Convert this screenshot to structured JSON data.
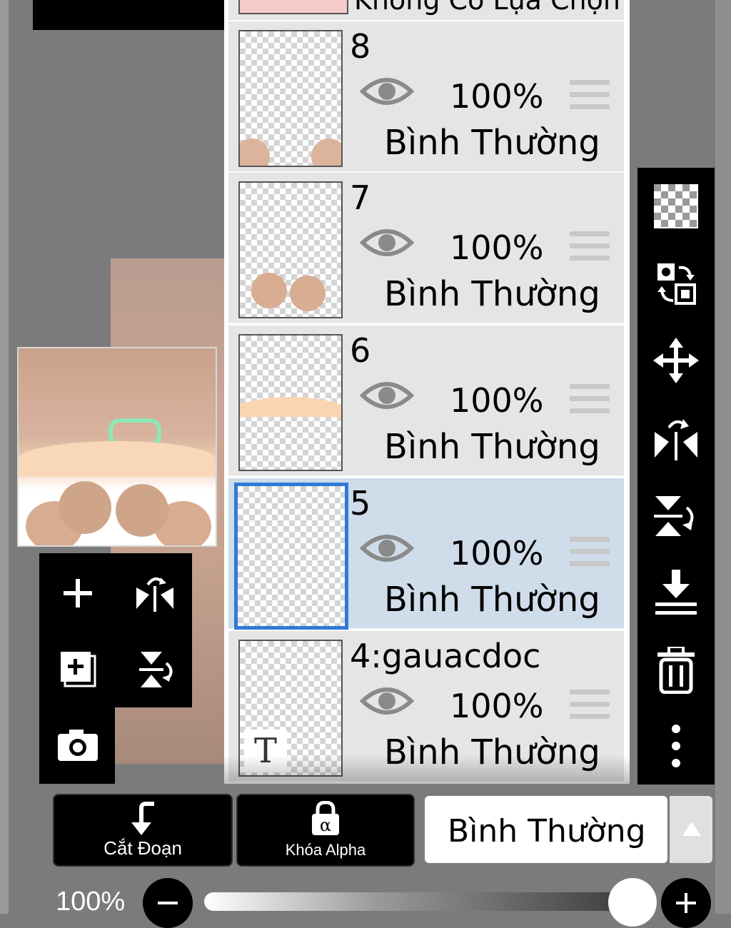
{
  "layers_panel": {
    "top_partial_label": "Không Có Lựa Chọn",
    "layers": [
      {
        "name": "8",
        "opacity": "100%",
        "blend_mode": "Bình Thường",
        "visible": true,
        "selected": false
      },
      {
        "name": "7",
        "opacity": "100%",
        "blend_mode": "Bình Thường",
        "visible": true,
        "selected": false
      },
      {
        "name": "6",
        "opacity": "100%",
        "blend_mode": "Bình Thường",
        "visible": true,
        "selected": false
      },
      {
        "name": "5",
        "opacity": "100%",
        "blend_mode": "Bình Thường",
        "visible": true,
        "selected": true
      },
      {
        "name": "4:gauacdoc",
        "opacity": "100%",
        "blend_mode": "Bình Thường",
        "visible": true,
        "selected": false
      }
    ]
  },
  "right_toolbar": {
    "icons": [
      "transparent-background-icon",
      "swap-layers-icon",
      "move-icon",
      "flip-horizontal-icon",
      "flip-vertical-icon",
      "merge-down-icon",
      "trash-icon",
      "more-icon"
    ]
  },
  "left_tools": {
    "icons": [
      "add-layer-icon",
      "flip-horizontal-icon",
      "duplicate-layer-icon",
      "flip-vertical-icon",
      "camera-icon"
    ]
  },
  "bottom_bar": {
    "clipping_label": "Cắt Đoạn",
    "alpha_lock_label": "Khóa Alpha",
    "blend_mode_value": "Bình Thường",
    "opacity_label": "100%",
    "opacity_value": 1.0
  },
  "layer_text_icon": "T",
  "colors": {
    "selection_highlight": "#cfdcea",
    "selected_border": "#2f7ad8"
  }
}
